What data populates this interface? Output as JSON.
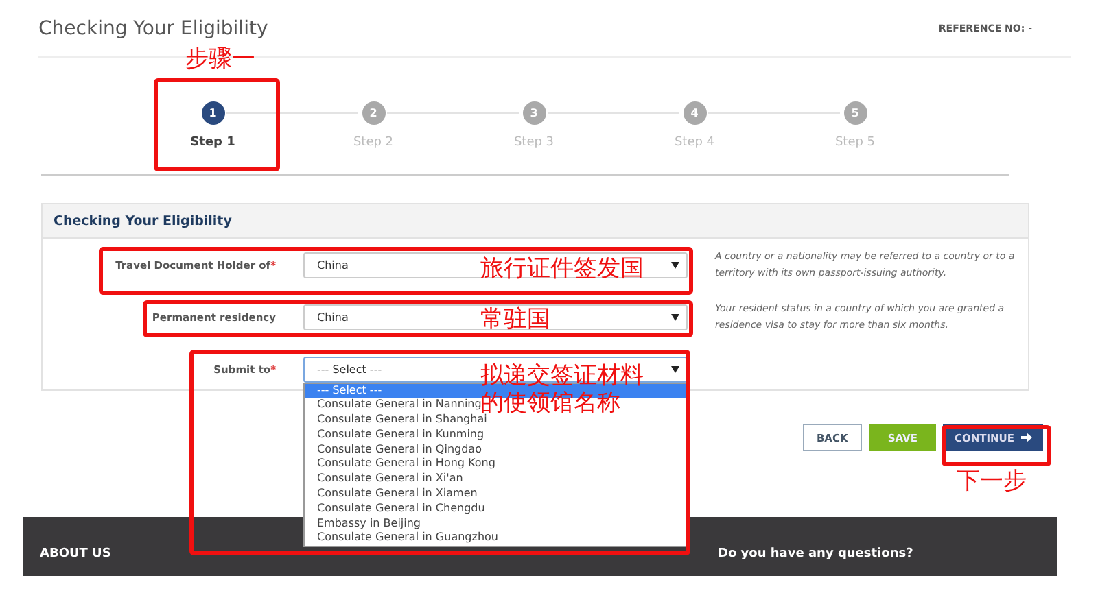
{
  "header": {
    "title": "Checking Your Eligibility",
    "reference": "REFERENCE NO: -"
  },
  "steps": [
    {
      "number": "1",
      "label": "Step 1",
      "selected": true
    },
    {
      "number": "2",
      "label": "Step 2",
      "selected": false
    },
    {
      "number": "3",
      "label": "Step 3",
      "selected": false
    },
    {
      "number": "4",
      "label": "Step 4",
      "selected": false
    },
    {
      "number": "5",
      "label": "Step 5",
      "selected": false
    }
  ],
  "panel": {
    "title": "Checking Your Eligibility",
    "fields": [
      {
        "label": "Travel Document Holder of",
        "required_mark": "*",
        "value": "China",
        "help": "A country or a nationality may be referred to a country or to a territory with its own passport-issuing authority.",
        "expanded": false
      },
      {
        "label": "Permanent residency",
        "value": "China",
        "help": "Your resident status in a country of which you are granted a residence visa to stay for more than six months.",
        "expanded": false
      },
      {
        "label": "Submit to",
        "required_mark": "*",
        "value": "--- Select ---",
        "expanded": true,
        "options": [
          {
            "label": "--- Select ---",
            "selected": true
          },
          {
            "label": "Consulate General in Nanning",
            "selected": false
          },
          {
            "label": "Consulate General in Shanghai",
            "selected": false
          },
          {
            "label": "Consulate General in Kunming",
            "selected": false
          },
          {
            "label": "Consulate General in Qingdao",
            "selected": false
          },
          {
            "label": "Consulate General in Hong Kong",
            "selected": false
          },
          {
            "label": "Consulate General in Xi'an",
            "selected": false
          },
          {
            "label": "Consulate General in Xiamen",
            "selected": false
          },
          {
            "label": "Consulate General in Chengdu",
            "selected": false
          },
          {
            "label": "Embassy in Beijing",
            "selected": false
          },
          {
            "label": "Consulate General in Guangzhou",
            "selected": false
          }
        ]
      }
    ]
  },
  "buttons": [
    {
      "label": "BACK",
      "kind": "outline"
    },
    {
      "label": "SAVE",
      "kind": "green"
    },
    {
      "label": "CONTINUE",
      "kind": "primary"
    }
  ],
  "footer": {
    "columns": [
      "ABOUT US",
      "Do you have any questions?"
    ]
  },
  "annotations": [
    {
      "label": "步骤一"
    },
    {
      "label": "旅行证件签发国"
    },
    {
      "label": "常驻国"
    },
    {
      "label": "拟递交签证材料的使领馆名称"
    },
    {
      "label": "下一步"
    }
  ]
}
